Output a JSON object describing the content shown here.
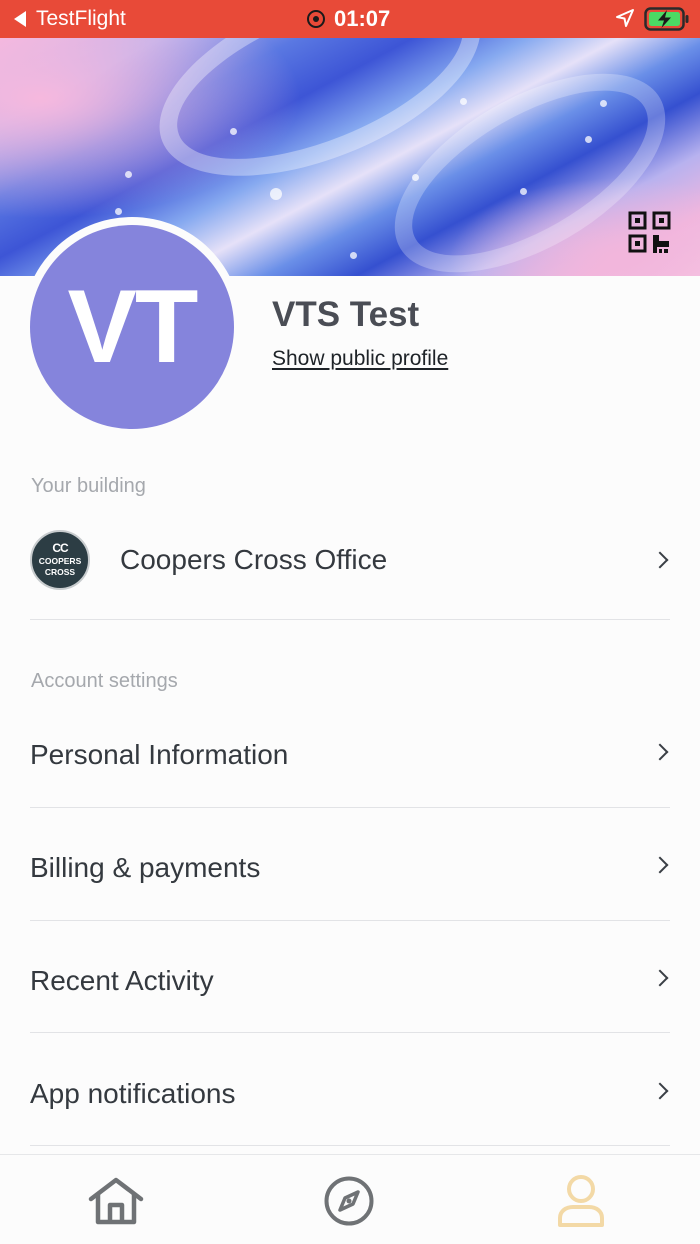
{
  "status_bar": {
    "back_app": "TestFlight",
    "time": "01:07"
  },
  "profile": {
    "initials": "VT",
    "name": "VTS Test",
    "public_profile_link": "Show public profile"
  },
  "building_section": {
    "label": "Your building",
    "building": {
      "name": "Coopers Cross Office",
      "logo_monogram": "CC",
      "logo_text_line1": "COOPERS",
      "logo_text_line2": "CROSS"
    }
  },
  "account_section": {
    "label": "Account settings",
    "items": [
      {
        "label": "Personal Information"
      },
      {
        "label": "Billing & payments"
      },
      {
        "label": "Recent Activity"
      },
      {
        "label": "App notifications"
      }
    ]
  },
  "tab_bar": {
    "tabs": [
      {
        "icon": "home-icon",
        "active": false
      },
      {
        "icon": "compass-icon",
        "active": false
      },
      {
        "icon": "person-icon",
        "active": true
      }
    ]
  },
  "colors": {
    "status_bar": "#e84a38",
    "avatar": "#8584dc",
    "active_tab": "#f3d9a6",
    "inactive_tab": "#6f7275"
  }
}
